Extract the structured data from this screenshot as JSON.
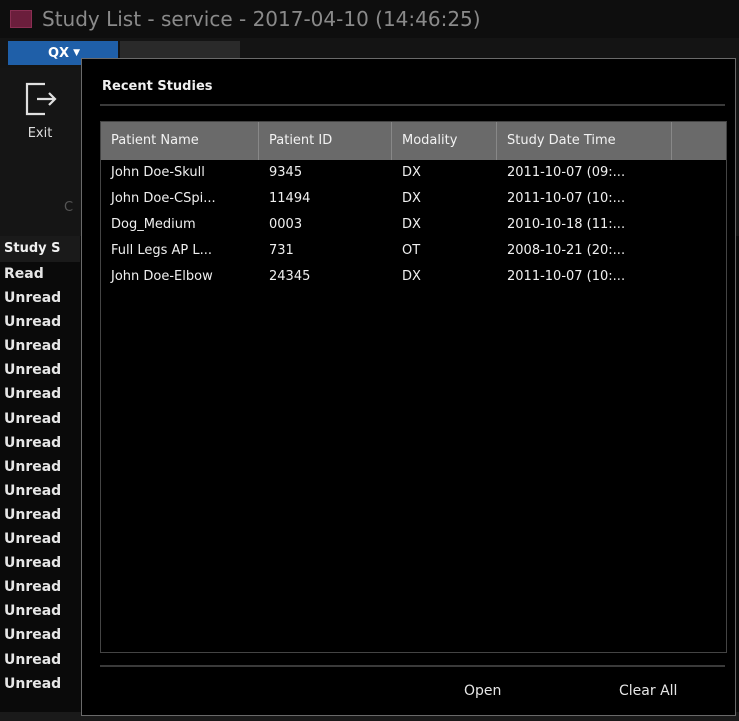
{
  "window": {
    "title": "Study List - service - 2017-04-10 (14:46:25)"
  },
  "ribbon": {
    "qx_tab": "QX",
    "exit_label": "Exit",
    "cut_label": "C"
  },
  "study_list": {
    "header": "Study S",
    "rows": [
      "Read",
      "Unread",
      "Unread",
      "Unread",
      "Unread",
      "Unread",
      "Unread",
      "Unread",
      "Unread",
      "Unread",
      "Unread",
      "Unread",
      "Unread",
      "Unread",
      "Unread",
      "Unread",
      "Unread",
      "Unread"
    ]
  },
  "popup": {
    "title": "Recent Studies",
    "columns": [
      "Patient Name",
      "Patient ID",
      "Modality",
      "Study Date Time",
      ""
    ],
    "rows": [
      {
        "name": "John Doe-Skull",
        "id": "9345",
        "modality": "DX",
        "date": "2011-10-07 (09:..."
      },
      {
        "name": "John Doe-CSpi...",
        "id": "11494",
        "modality": "DX",
        "date": "2011-10-07 (10:..."
      },
      {
        "name": "Dog_Medium",
        "id": "0003",
        "modality": "DX",
        "date": "2010-10-18 (11:..."
      },
      {
        "name": "Full Legs AP L...",
        "id": "731",
        "modality": "OT",
        "date": "2008-10-21 (20:..."
      },
      {
        "name": "John Doe-Elbow",
        "id": "24345",
        "modality": "DX",
        "date": "2011-10-07 (10:..."
      }
    ],
    "open_label": "Open",
    "clear_label": "Clear All"
  },
  "colors": {
    "accent": "#1f5fa8",
    "header_bg": "#6a6a6a",
    "app_icon": "#6b1e3c"
  }
}
